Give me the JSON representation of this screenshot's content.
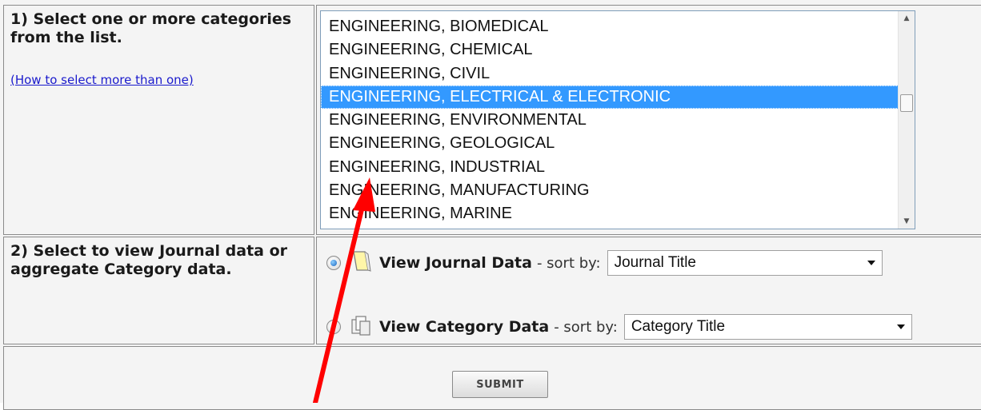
{
  "step1": {
    "label": "1) Select one or more categories from the list.",
    "help_link": "(How to select more than one)"
  },
  "categories": {
    "items": [
      "ENGINEERING, BIOMEDICAL",
      "ENGINEERING, CHEMICAL",
      "ENGINEERING, CIVIL",
      "ENGINEERING, ELECTRICAL & ELECTRONIC",
      "ENGINEERING, ENVIRONMENTAL",
      "ENGINEERING, GEOLOGICAL",
      "ENGINEERING, INDUSTRIAL",
      "ENGINEERING, MANUFACTURING",
      "ENGINEERING, MARINE"
    ],
    "selected": "ENGINEERING, ELECTRICAL & ELECTRONIC"
  },
  "step2": {
    "label": "2) Select to view Journal data or aggregate Category data.",
    "journal": {
      "label": "View Journal Data",
      "sort_text": "- sort by:",
      "sort_value": "Journal Title",
      "icon": "journal-icon",
      "checked": true
    },
    "category": {
      "label": "View Category Data",
      "sort_text": "- sort by:",
      "sort_value": "Category Title",
      "icon": "category-icon",
      "checked": false
    }
  },
  "submit": {
    "label": "SUBMIT"
  },
  "colors": {
    "selection": "#3399ff",
    "link": "#1a1acc",
    "annotation_arrow": "#ff0000"
  }
}
